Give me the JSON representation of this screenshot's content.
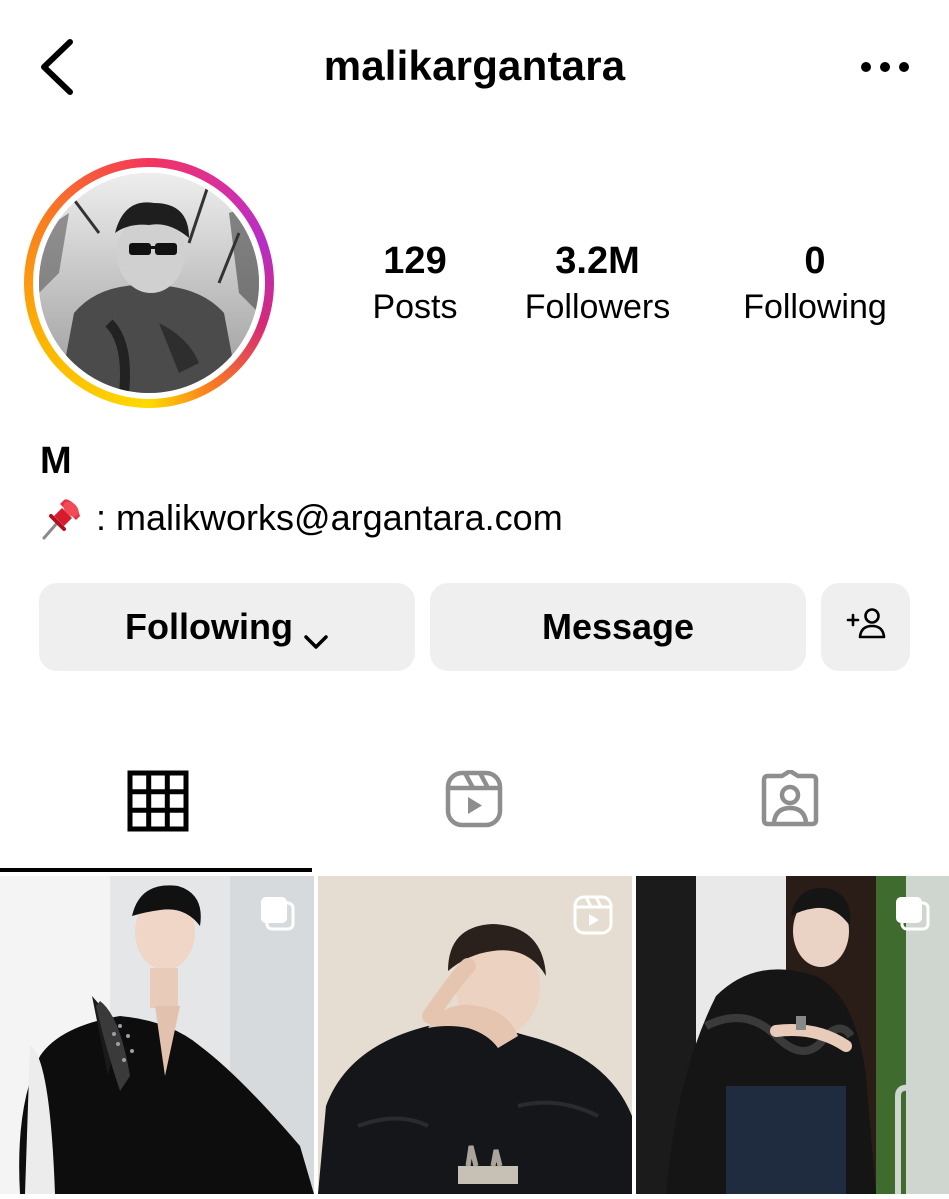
{
  "header": {
    "username": "malikargantara",
    "back_icon": "chevron-left-icon",
    "more_icon": "more-horizontal-icon"
  },
  "stats": {
    "posts": {
      "value": "129",
      "label": "Posts"
    },
    "followers": {
      "value": "3.2M",
      "label": "Followers"
    },
    "following": {
      "value": "0",
      "label": "Following"
    }
  },
  "profile": {
    "display_name": "M",
    "bio_icon": "pushpin-emoji",
    "bio_text": ": malikworks@argantara.com"
  },
  "actions": {
    "following_label": "Following",
    "message_label": "Message",
    "add_user_icon": "add-user-icon"
  },
  "tabs": [
    {
      "name": "posts-grid",
      "icon": "grid-icon",
      "active": true
    },
    {
      "name": "reels",
      "icon": "reels-icon",
      "active": false
    },
    {
      "name": "tagged",
      "icon": "tagged-user-icon",
      "active": false
    }
  ],
  "posts": [
    {
      "type": "carousel",
      "badge_icon": "carousel-icon"
    },
    {
      "type": "reel",
      "badge_icon": "reel-icon"
    },
    {
      "type": "carousel",
      "badge_icon": "carousel-icon"
    }
  ],
  "colors": {
    "button_bg": "#efefef",
    "ring_gradient": [
      "#feda00",
      "#fa7e1e",
      "#d62976",
      "#b42fc7"
    ],
    "inactive_icon": "#8e8e8e"
  }
}
